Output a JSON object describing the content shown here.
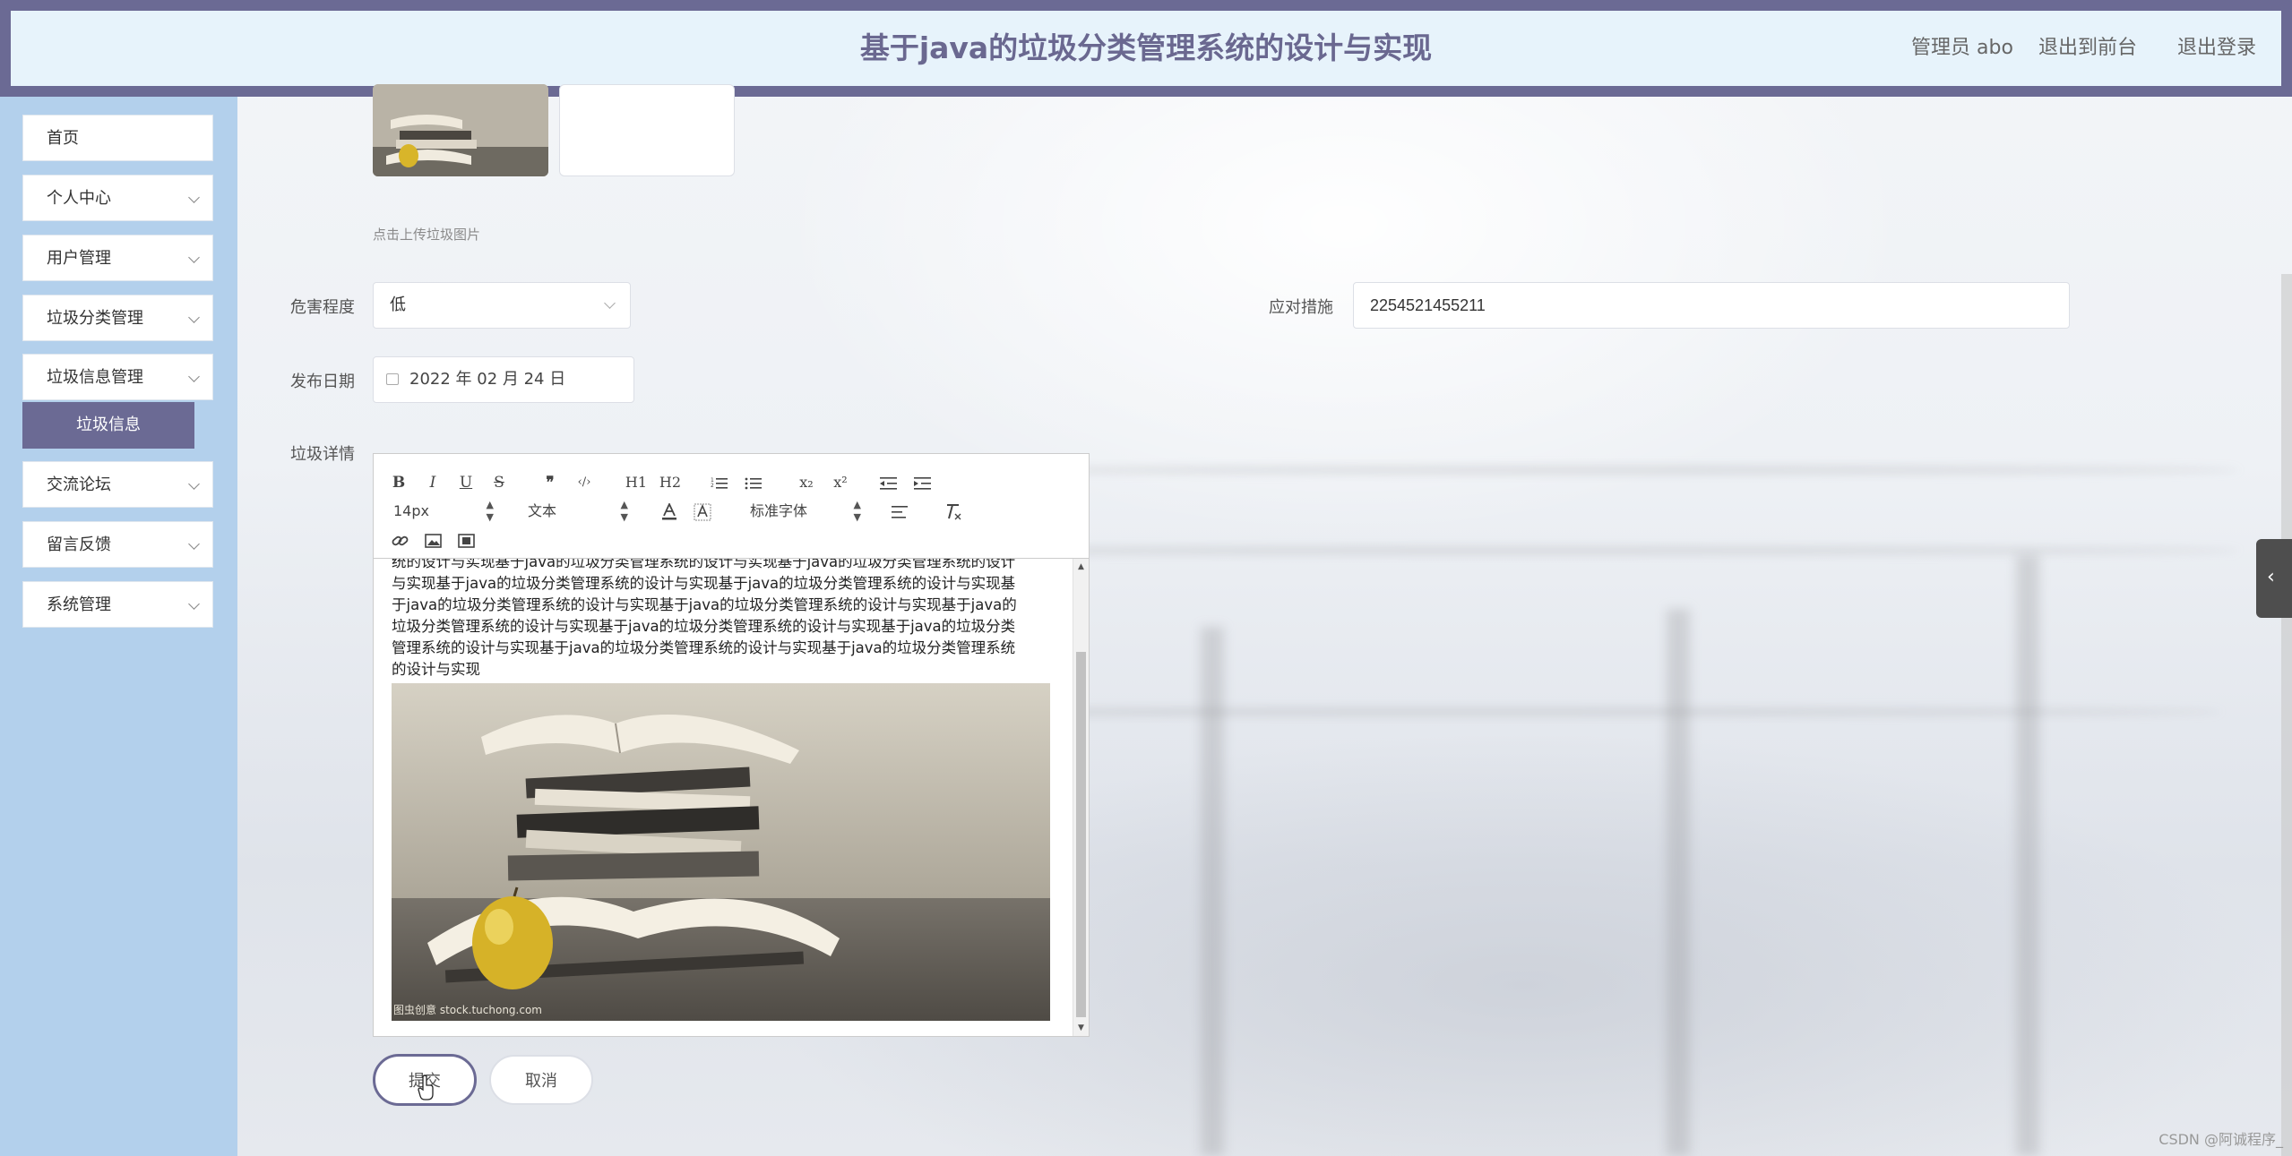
{
  "header": {
    "title": "基于java的垃圾分类管理系统的设计与实现",
    "user_label": "管理员 abo",
    "to_frontend": "退出到前台",
    "logout": "退出登录"
  },
  "sidebar": {
    "items": [
      {
        "label": "首页"
      },
      {
        "label": "个人中心"
      },
      {
        "label": "用户管理"
      },
      {
        "label": "垃圾分类管理"
      },
      {
        "label": "垃圾信息管理"
      },
      {
        "label": "交流论坛"
      },
      {
        "label": "留言反馈"
      },
      {
        "label": "系统管理"
      }
    ],
    "active_sub": "垃圾信息"
  },
  "form": {
    "upload_hint": "点击上传垃圾图片",
    "danger_label": "危害程度",
    "danger_value": "低",
    "measure_label": "应对措施",
    "measure_value": "2254521455211",
    "date_label": "发布日期",
    "date_value": "2022 年 02 月 24 日",
    "detail_label": "垃圾详情",
    "submit": "提交",
    "cancel": "取消"
  },
  "editor": {
    "font_size": "14px",
    "block_type": "文本",
    "font_family": "标准字体",
    "lines": [
      "统的设计与实现基于java的垃圾分类管理系统的设计与实现基于java的垃圾分类管理系统的设计",
      "与实现基于java的垃圾分类管理系统的设计与实现基于java的垃圾分类管理系统的设计与实现基",
      "于java的垃圾分类管理系统的设计与实现基于java的垃圾分类管理系统的设计与实现基于java的",
      "垃圾分类管理系统的设计与实现基于java的垃圾分类管理系统的设计与实现基于java的垃圾分类",
      "管理系统的设计与实现基于java的垃圾分类管理系统的设计与实现基于java的垃圾分类管理系统",
      "的设计与实现"
    ],
    "image_watermark": "图虫创意 stock.tuchong.com"
  },
  "corner_watermark": "CSDN @阿诚程序_",
  "icons": {
    "bold": "B",
    "italic": "I",
    "underline": "U",
    "strike": "S",
    "blockquote": "❞",
    "code": "‹/›",
    "h1": "H1",
    "h2": "H2",
    "sub": "x₂",
    "sup": "x²"
  }
}
